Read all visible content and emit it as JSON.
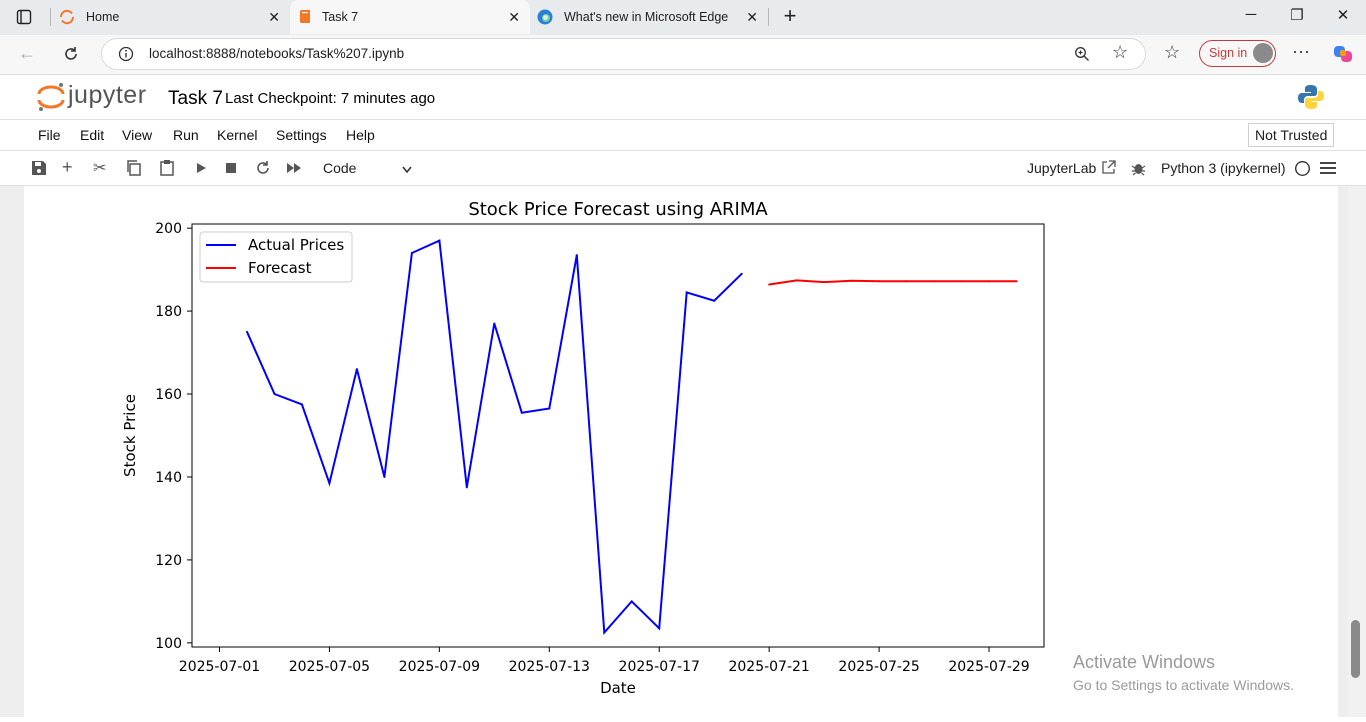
{
  "browser": {
    "tabs": [
      {
        "title": "Home"
      },
      {
        "title": "Task 7"
      },
      {
        "title": "What's new in Microsoft Edge"
      }
    ],
    "url": "localhost:8888/notebooks/Task%207.ipynb",
    "sign_in_label": "Sign in"
  },
  "jupyter": {
    "logo_text": "jupyter",
    "notebook_title": "Task 7",
    "checkpoint": "Last Checkpoint: 7 minutes ago",
    "menu": [
      "File",
      "Edit",
      "View",
      "Run",
      "Kernel",
      "Settings",
      "Help"
    ],
    "trust_status": "Not Trusted",
    "cell_type": "Code",
    "jupyterlab_label": "JupyterLab",
    "kernel": "Python 3 (ipykernel)"
  },
  "watermark": {
    "line1": "Activate Windows",
    "line2": "Go to Settings to activate Windows."
  },
  "colors": {
    "actual": "#0000ff",
    "forecast": "#ff0000",
    "accent": "#f37726"
  },
  "chart_data": {
    "type": "line",
    "title": "Stock Price Forecast using ARIMA",
    "xlabel": "Date",
    "ylabel": "Stock Price",
    "ylim": [
      99,
      201
    ],
    "xlim": [
      "2025-06-30",
      "2025-07-31"
    ],
    "yticks": [
      100,
      120,
      140,
      160,
      180,
      200
    ],
    "xticks": [
      "2025-07-01",
      "2025-07-05",
      "2025-07-09",
      "2025-07-13",
      "2025-07-17",
      "2025-07-21",
      "2025-07-25",
      "2025-07-29"
    ],
    "grid": false,
    "legend_position": "top-left",
    "series": [
      {
        "name": "Actual Prices",
        "color": "#0000ff",
        "x": [
          "2025-07-02",
          "2025-07-03",
          "2025-07-04",
          "2025-07-05",
          "2025-07-06",
          "2025-07-07",
          "2025-07-08",
          "2025-07-09",
          "2025-07-10",
          "2025-07-11",
          "2025-07-12",
          "2025-07-13",
          "2025-07-14",
          "2025-07-15",
          "2025-07-16",
          "2025-07-17",
          "2025-07-18",
          "2025-07-19",
          "2025-07-20"
        ],
        "y": [
          175,
          160,
          157.5,
          138.5,
          166,
          140,
          194,
          197,
          137.5,
          177,
          155.5,
          156.5,
          193.5,
          102.5,
          110,
          103.5,
          184.5,
          182.5,
          189
        ]
      },
      {
        "name": "Forecast",
        "color": "#ff0000",
        "x": [
          "2025-07-21",
          "2025-07-22",
          "2025-07-23",
          "2025-07-24",
          "2025-07-25",
          "2025-07-26",
          "2025-07-27",
          "2025-07-28",
          "2025-07-29",
          "2025-07-30"
        ],
        "y": [
          186.4,
          187.4,
          187.0,
          187.3,
          187.2,
          187.2,
          187.2,
          187.2,
          187.2,
          187.2
        ]
      }
    ]
  }
}
